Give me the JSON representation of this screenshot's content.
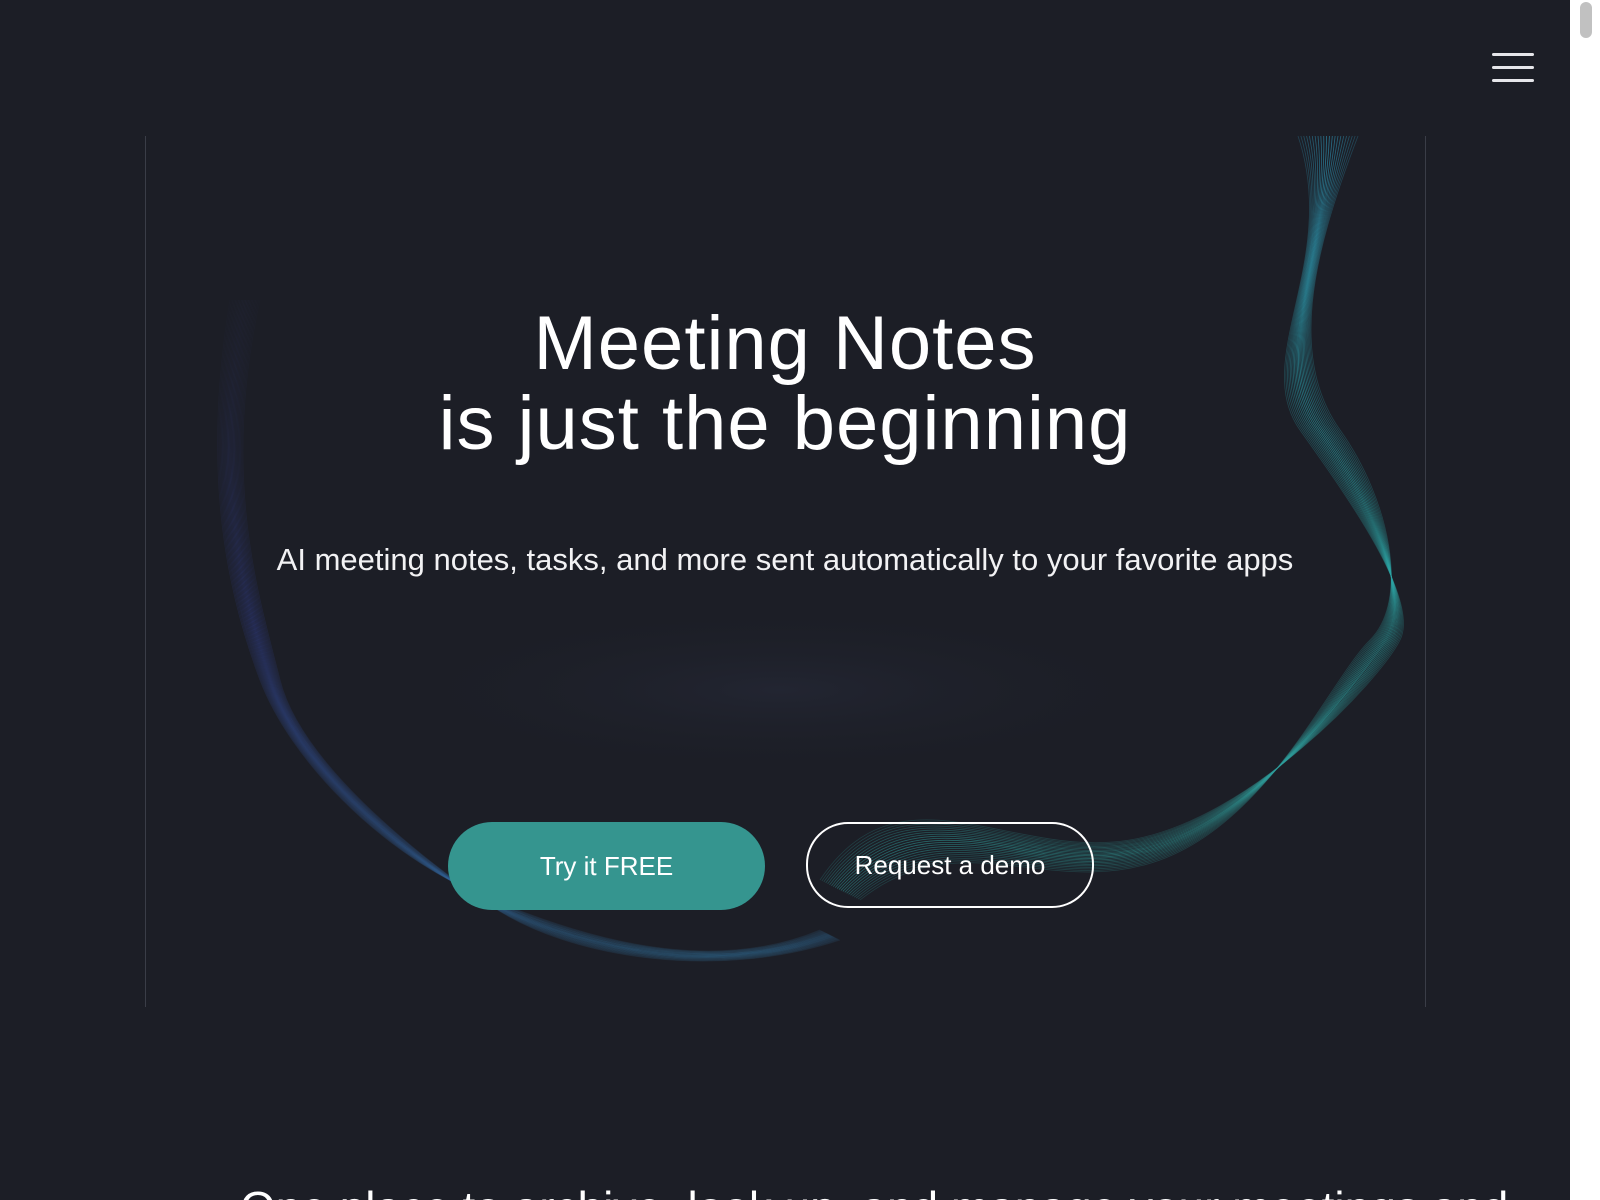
{
  "header": {
    "menu_icon": "hamburger-menu-icon"
  },
  "hero": {
    "title_line1": "Meeting Notes",
    "title_line2": "is just the beginning",
    "subtitle": "AI meeting notes, tasks, and more sent automatically to your favorite apps",
    "primary_cta": "Try it FREE",
    "secondary_cta": "Request a demo"
  },
  "next_section": {
    "heading_partial": "One place to archive, look up, and manage your meetings and"
  },
  "colors": {
    "background": "#1c1e26",
    "accent": "#35958f",
    "wave_teal": "#3aa3a6",
    "wave_blue": "#3a4fb0"
  }
}
